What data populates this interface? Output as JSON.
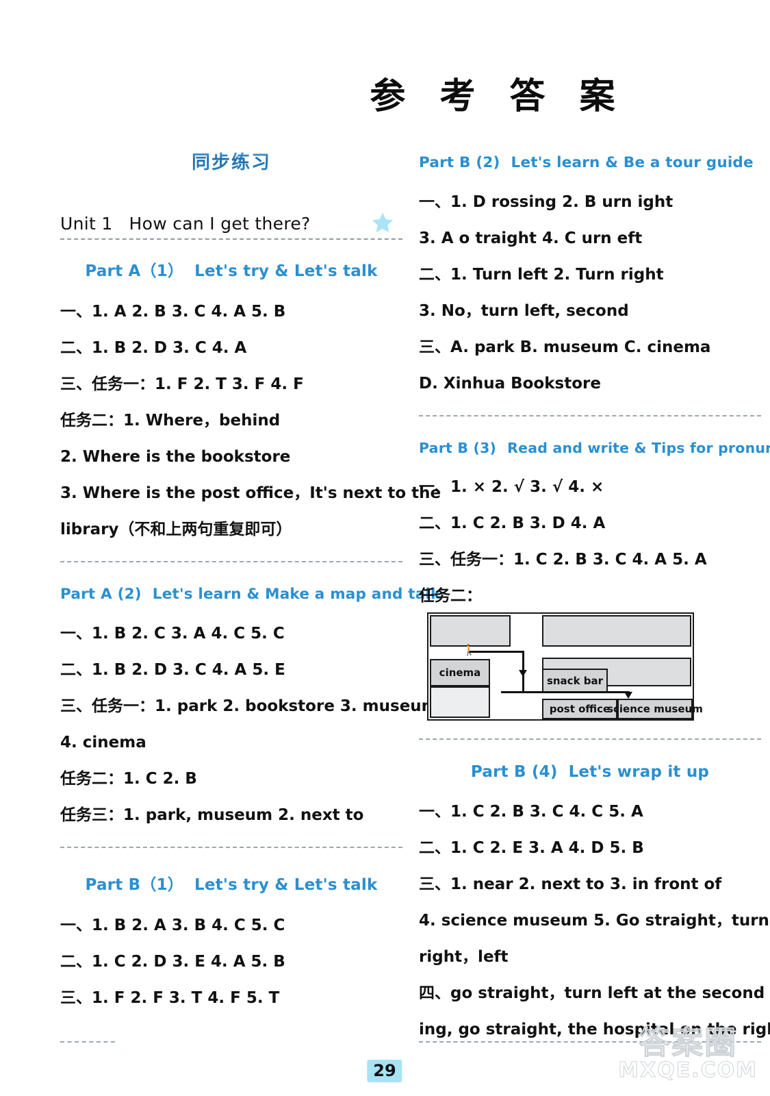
{
  "doc": {
    "title": "参 考 答 案",
    "page_number": "29"
  },
  "watermark": {
    "cn": "答案圈",
    "en": "MXQE.COM"
  },
  "left": {
    "section_title": "同步练习",
    "unit": {
      "number": "Unit 1",
      "name": "How can I get there?",
      "star_icon": "star-icon"
    },
    "partA1": {
      "part": "Part A（1）",
      "name": "Let's try & Let's talk",
      "lines": [
        "一、1. A   2. B   3. C   4. A   5. B",
        "二、1. B   2. D   3. C   4. A",
        "三、任务一：1. F   2. T   3. F   4. F",
        "任务二：1. Where，behind",
        "2. Where is the bookstore",
        "3. Where is the post office，It's next to the",
        "library（不和上两句重复即可）"
      ]
    },
    "partA2": {
      "part": "Part A (2)",
      "name": "Let's learn & Make a map and talk",
      "lines": [
        "一、1. B   2. C   3. A   4. C   5. C",
        "二、1. B   2. D   3. C   4. A   5. E",
        "三、任务一：1. park   2. bookstore   3. museum",
        "4. cinema",
        "任务二：1. C   2. B",
        "任务三：1. park, museum   2. next to"
      ]
    },
    "partB1": {
      "part": "Part B（1）",
      "name": "Let's try & Let's talk",
      "lines": [
        "一、1. B   2. A   3. B   4. C   5. C",
        "二、1. C   2. D   3. E   4. A   5. B",
        "三、1. F   2. F   3. T   4. F   5. T"
      ]
    }
  },
  "right": {
    "partB2": {
      "part": "Part B (2)",
      "name": "Let's learn & Be a tour guide",
      "lines": [
        "一、1. D   rossing   2. B   urn   ight",
        "3. A   o   traight   4. C   urn   eft",
        "二、1. Turn left   2. Turn right",
        "3. No，turn left, second",
        "三、A. park   B. museum   C. cinema",
        "D. Xinhua Bookstore"
      ]
    },
    "partB3": {
      "part": "Part B (3)",
      "name": "Read and write & Tips for pronunciation",
      "lines": [
        "一、1. ×   2. √   3. √   4. ×",
        "二、1. C   2. B   3. D   4. A",
        "三、任务一：1. C   2. B   3. C   4. A   5. A",
        "任务二："
      ],
      "map": {
        "label_cinema": "cinema",
        "label_snack_bar": "snack bar",
        "label_post_office": "post office",
        "label_science_museum": "science museum",
        "person_icon": "walking-person-icon",
        "arrow_icon": "route-arrow-icon"
      }
    },
    "partB4": {
      "part": "Part B (4)",
      "name": "Let's wrap it up",
      "lines": [
        "一、1. C   2. B   3. C   4. C   5. A",
        "二、1. C   2. E   3. A   4. D   5. B",
        "三、1. near   2. next to   3. in front of",
        "4. science  museum     5. Go  straight，turn",
        "right，left",
        "四、go straight，turn left at the second cross-",
        "ing, go straight, the hospital on the right"
      ]
    }
  }
}
